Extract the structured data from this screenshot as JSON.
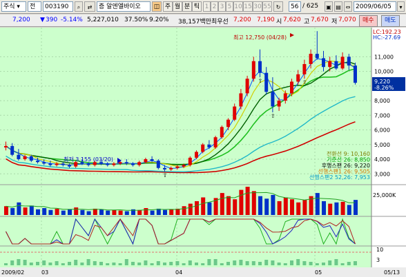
{
  "toolbar": {
    "market": "주식",
    "period_type": "전",
    "stock_code": "003190",
    "stock_name": "알엔엘바이오",
    "grade": "증",
    "period_buttons": [
      "주",
      "월",
      "분",
      "틱"
    ],
    "period_selected": "주",
    "minute_options": [
      "1",
      "2",
      "3",
      "5",
      "10",
      "15",
      "30",
      "55"
    ],
    "count_value": "56",
    "count_total": "/ 625",
    "date": "2009/06/05"
  },
  "info": {
    "price": "7,200",
    "change": "390",
    "change_pct": "-5.14%",
    "volume": "5,227,010",
    "pct2": "37.50%",
    "pct3": "9.20%",
    "amount": "38,157백만",
    "best_label": "최우선",
    "best_value": "7,200",
    "best_value2": "7,190",
    "open_label": "시",
    "open_value": "7,620",
    "high_label": "고",
    "high_value": "7,670",
    "low_label": "저",
    "low_value": "7,070",
    "buy_label": "매수",
    "sell_label": "매도"
  },
  "chart": {
    "price_axis_labels": [
      "11,000",
      "10,000",
      "9,000",
      "8,000",
      "7,000",
      "6,000",
      "5,000",
      "4,000",
      "3,000"
    ],
    "lc_label": "LC:192.23",
    "hc_label": "HC:-27.69",
    "current_value": "9,220",
    "current_pct": "-8.26%",
    "high_annotation": "최고 12,750 (04/28)",
    "low_annotation": "최저 3,155 (03/20)",
    "volume_axis_label": "25,000K",
    "osc_axis_labels": [
      "10",
      "3"
    ],
    "legend": [
      {
        "text": "전환선 9: 10,160",
        "color": "#7c7c00"
      },
      {
        "text": "기준선 26: 8,850",
        "color": "#00a000"
      },
      {
        "text": "후행스팬 26: 9,220",
        "color": "#000000"
      },
      {
        "text": "선행스팬1 26: 9,505",
        "color": "#d07000"
      },
      {
        "text": "선행스팬2 52,26: 7,953",
        "color": "#0096c8"
      }
    ],
    "date_labels": [
      "2009/02",
      "03",
      "04",
      "05",
      "05/13"
    ],
    "colors": {
      "up": "#e00000",
      "down": "#0030c8",
      "bg": "#ccffcc",
      "volume_bg": "#ccffcc"
    }
  },
  "chart_data": {
    "type": "candlestick",
    "candles": [
      [
        4800,
        5200,
        4600,
        4900
      ],
      [
        4900,
        5100,
        4200,
        4300
      ],
      [
        4300,
        4700,
        3900,
        4000
      ],
      [
        4000,
        4300,
        3900,
        4200
      ],
      [
        4200,
        4300,
        3800,
        3900
      ],
      [
        3900,
        4100,
        3700,
        3800
      ],
      [
        3800,
        4000,
        3600,
        3700
      ],
      [
        3700,
        3900,
        3500,
        3600
      ],
      [
        3600,
        3800,
        3500,
        3700
      ],
      [
        3700,
        3800,
        3500,
        3600
      ],
      [
        3600,
        3700,
        3400,
        3500
      ],
      [
        3500,
        3900,
        3400,
        3800
      ],
      [
        3800,
        4000,
        3600,
        3700
      ],
      [
        3700,
        3800,
        3500,
        3600
      ],
      [
        3600,
        3900,
        3500,
        3800
      ],
      [
        3800,
        4000,
        3600,
        3700
      ],
      [
        3700,
        3800,
        3500,
        3600
      ],
      [
        3600,
        3800,
        3500,
        3700
      ],
      [
        3700,
        3900,
        3600,
        3800
      ],
      [
        3800,
        4000,
        3600,
        3700
      ],
      [
        3700,
        3800,
        3500,
        3600
      ],
      [
        3600,
        3900,
        3500,
        3800
      ],
      [
        3800,
        4100,
        3700,
        4000
      ],
      [
        4000,
        4200,
        3800,
        3900
      ],
      [
        3900,
        4000,
        3300,
        3400
      ],
      [
        3400,
        3600,
        3155,
        3300
      ],
      [
        3300,
        3500,
        3200,
        3400
      ],
      [
        3400,
        3600,
        3300,
        3500
      ],
      [
        3500,
        3700,
        3400,
        3600
      ],
      [
        3600,
        4200,
        3500,
        4100
      ],
      [
        4100,
        4600,
        4000,
        4500
      ],
      [
        4500,
        5100,
        4400,
        5000
      ],
      [
        5000,
        5300,
        4700,
        4800
      ],
      [
        4800,
        5600,
        4700,
        5500
      ],
      [
        5500,
        6300,
        5400,
        6200
      ],
      [
        6200,
        6800,
        6000,
        6700
      ],
      [
        6700,
        7800,
        6600,
        7600
      ],
      [
        7600,
        8800,
        7400,
        8500
      ],
      [
        8500,
        9700,
        8300,
        9500
      ],
      [
        9500,
        11000,
        9300,
        10700
      ],
      [
        10700,
        11500,
        9600,
        9900
      ],
      [
        9900,
        10300,
        8400,
        8600
      ],
      [
        8600,
        9600,
        7200,
        7600
      ],
      [
        7600,
        8200,
        7300,
        8000
      ],
      [
        8000,
        8700,
        7800,
        8500
      ],
      [
        8500,
        9500,
        8300,
        9300
      ],
      [
        9300,
        10100,
        9100,
        9800
      ],
      [
        9800,
        10800,
        9500,
        10500
      ],
      [
        10500,
        11500,
        10200,
        11200
      ],
      [
        11200,
        12750,
        10800,
        10900
      ],
      [
        10900,
        11400,
        10000,
        10300
      ],
      [
        10300,
        11000,
        10000,
        10700
      ],
      [
        10700,
        11100,
        10100,
        10200
      ],
      [
        10200,
        11300,
        10100,
        11000
      ],
      [
        11000,
        11200,
        10100,
        10400
      ],
      [
        10400,
        10600,
        9100,
        9220
      ]
    ],
    "volume": [
      14,
      11,
      20,
      12,
      15,
      9,
      11,
      8,
      10,
      7,
      9,
      12,
      8,
      6,
      10,
      9,
      7,
      8,
      7,
      6,
      9,
      8,
      11,
      7,
      10,
      8,
      9,
      10,
      14,
      18,
      22,
      28,
      20,
      27,
      35,
      30,
      25,
      40,
      45,
      38,
      30,
      26,
      32,
      22,
      28,
      25,
      20,
      24,
      30,
      35,
      22,
      18,
      20,
      21,
      16,
      24
    ],
    "volume_unit": "K"
  }
}
